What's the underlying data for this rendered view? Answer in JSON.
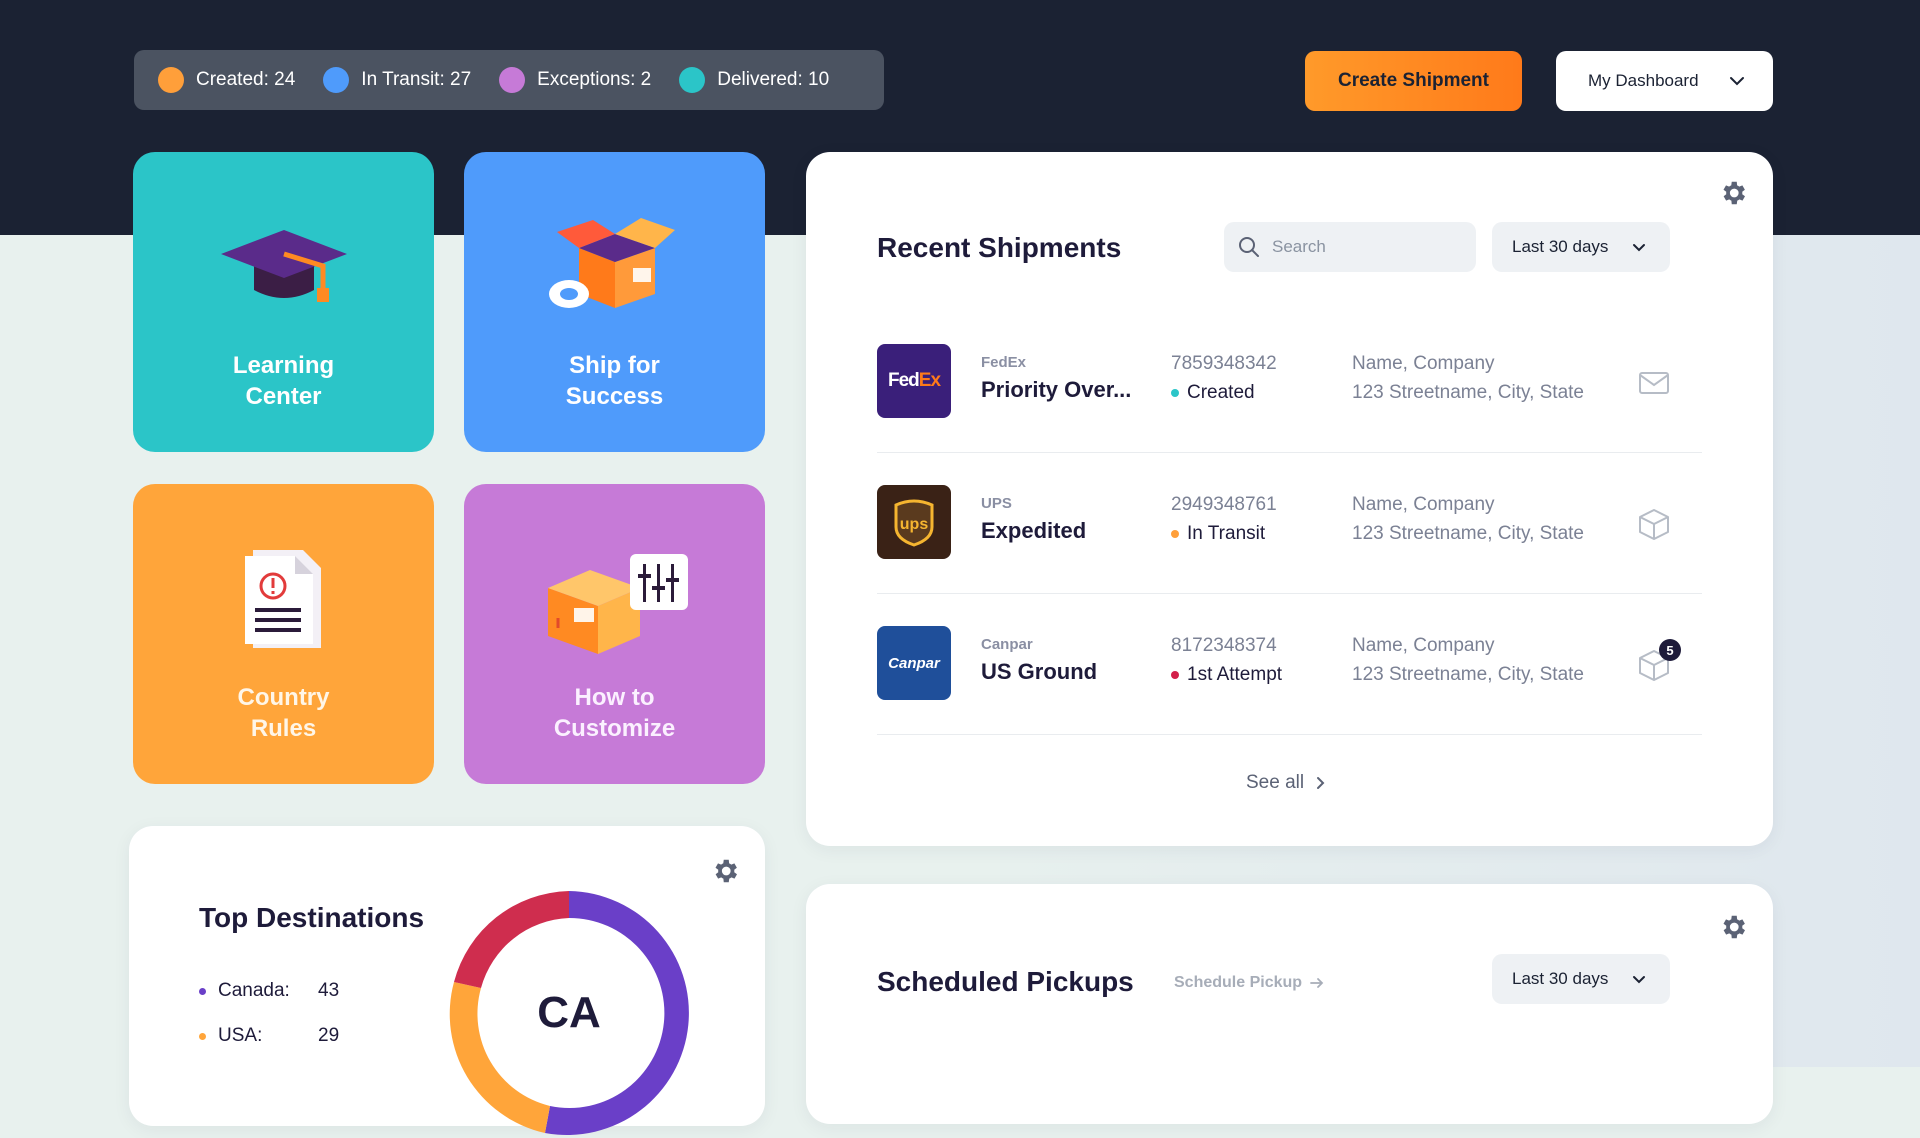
{
  "colors": {
    "created": "#ff9f3a",
    "in_transit": "#4f9bfb",
    "exceptions": "#c67ad7",
    "delivered": "#2bc5c8",
    "accent": "#ff8a22",
    "dark": "#1b2233"
  },
  "status_bar": [
    {
      "label": "Created: 24",
      "color": "#ff9f3a"
    },
    {
      "label": "In Transit: 27",
      "color": "#4f9bfb"
    },
    {
      "label": "Exceptions: 2",
      "color": "#c67ad7"
    },
    {
      "label": "Delivered: 10",
      "color": "#2bc5c8"
    }
  ],
  "header": {
    "create_label": "Create Shipment",
    "dashboard_select": "My Dashboard"
  },
  "tiles": [
    {
      "label": "Learning\nCenter",
      "icon": "graduation-cap-icon",
      "color": "#2bc5c8"
    },
    {
      "label": "Ship for\nSuccess",
      "icon": "open-box-icon",
      "color": "#4f9bfb"
    },
    {
      "label": "Country\nRules",
      "icon": "alert-document-icon",
      "color": "#ffa53a"
    },
    {
      "label": "How to\nCustomize",
      "icon": "box-settings-icon",
      "color": "#c67ad7"
    }
  ],
  "recent": {
    "title": "Recent Shipments",
    "search_placeholder": "Search",
    "range": "Last 30 days",
    "see_all": "See all",
    "rows": [
      {
        "carrier": "FedEx",
        "logo_text": "FedEx",
        "service": "Priority Over...",
        "tracking": "7859348342",
        "status": "Created",
        "status_color": "#2bc5c8",
        "addr_name": "Name, Company",
        "addr_line": "123 Streetname, City, State",
        "icon": "mail-icon",
        "badge": ""
      },
      {
        "carrier": "UPS",
        "logo_text": "ups",
        "service": "Expedited",
        "tracking": "2949348761",
        "status": "In Transit",
        "status_color": "#ff9f3a",
        "addr_name": "Name, Company",
        "addr_line": "123 Streetname, City, State",
        "icon": "package-icon",
        "badge": ""
      },
      {
        "carrier": "Canpar",
        "logo_text": "Canpar",
        "service": "US Ground",
        "tracking": "8172348374",
        "status": "1st Attempt",
        "status_color": "#d3204a",
        "addr_name": "Name, Company",
        "addr_line": "123 Streetname, City, State",
        "icon": "package-icon",
        "badge": "5"
      }
    ]
  },
  "destinations": {
    "title": "Top Destinations",
    "center_label": "CA",
    "items": [
      {
        "label": "Canada:",
        "value": "43",
        "color": "#6a3fc8"
      },
      {
        "label": "USA:",
        "value": "29",
        "color": "#ffa53a"
      }
    ]
  },
  "pickups": {
    "title": "Scheduled Pickups",
    "link": "Schedule Pickup",
    "range": "Last 30 days"
  }
}
